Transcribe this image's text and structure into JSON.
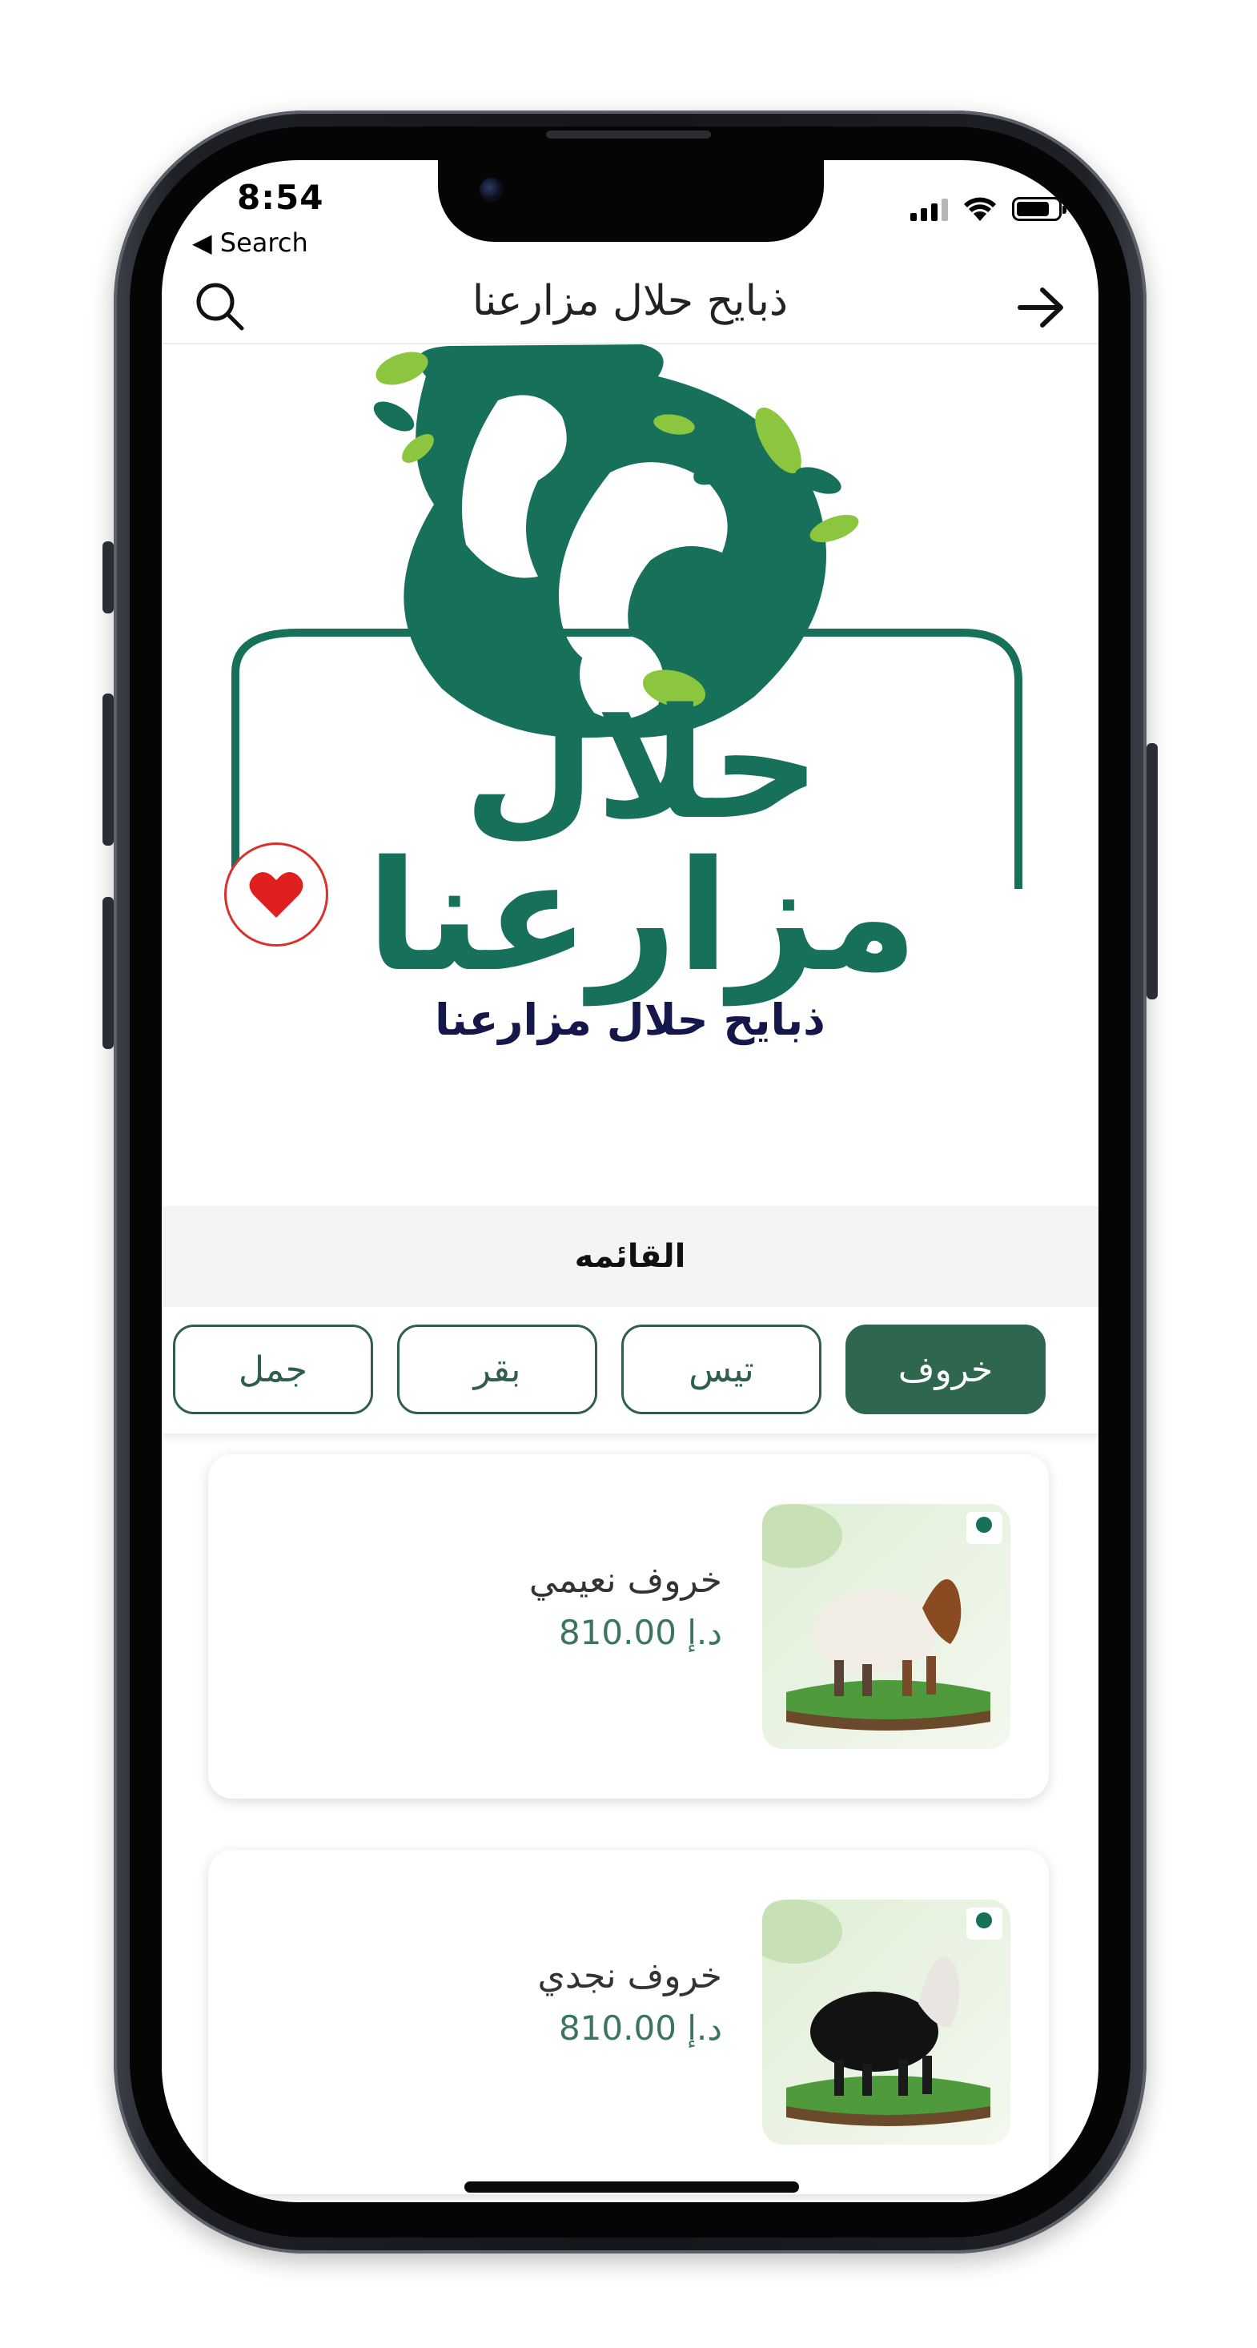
{
  "status_bar": {
    "time": "8:54",
    "back_label": "◀ Search",
    "battery_level": 0.8
  },
  "appbar": {
    "title": "ذبايح حلال مزارعنا",
    "left_icon": "search-icon",
    "right_icon": "arrow-right-icon"
  },
  "logo": {
    "wordmark": "حلال مزارعنا",
    "brand_green": "#17705a",
    "leaf_green": "#8cc63f"
  },
  "favorite": {
    "icon": "heart-icon",
    "color": "#e02020"
  },
  "store_name": "ذبايح حلال مزارعنا",
  "menu": {
    "header": "القائمه",
    "tabs": [
      {
        "label": "خروف",
        "active": true
      },
      {
        "label": "تيس",
        "active": false
      },
      {
        "label": "بقر",
        "active": false
      },
      {
        "label": "جمل",
        "active": false
      }
    ]
  },
  "products": [
    {
      "name": "خروف نعيمي",
      "price": "810.00 د.إ",
      "animal": "white-sheep-brown-head"
    },
    {
      "name": "خروف نجدي",
      "price": "810.00 د.إ",
      "animal": "black-sheep-white-head"
    }
  ],
  "colors": {
    "primary": "#2f6650",
    "accent_text": "#3b7560",
    "title_navy": "#15174a"
  }
}
